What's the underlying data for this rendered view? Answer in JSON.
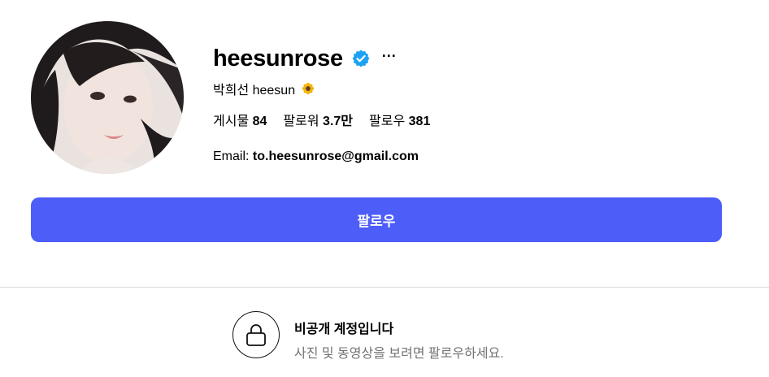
{
  "profile": {
    "username": "heesunrose",
    "more_label": "···",
    "full_name": "박희선 heesun",
    "stats": [
      {
        "label": "게시물",
        "value": "84"
      },
      {
        "label": "팔로워",
        "value": "3.7만"
      },
      {
        "label": "팔로우",
        "value": "381"
      }
    ],
    "bio_prefix": "Email: ",
    "bio_email": "to.heesunrose@gmail.com"
  },
  "actions": {
    "follow_label": "팔로우"
  },
  "private": {
    "title": "비공개 계정입니다",
    "subtitle": "사진 및 동영상을 보려면 팔로우하세요."
  },
  "colors": {
    "accent": "#4d5df7",
    "verified": "#1da1f2",
    "muted": "#737373"
  },
  "icons": {
    "verified": "verified-badge-icon",
    "more": "more-options-icon",
    "flower": "sunflower-emoji-icon",
    "lock": "lock-icon"
  }
}
